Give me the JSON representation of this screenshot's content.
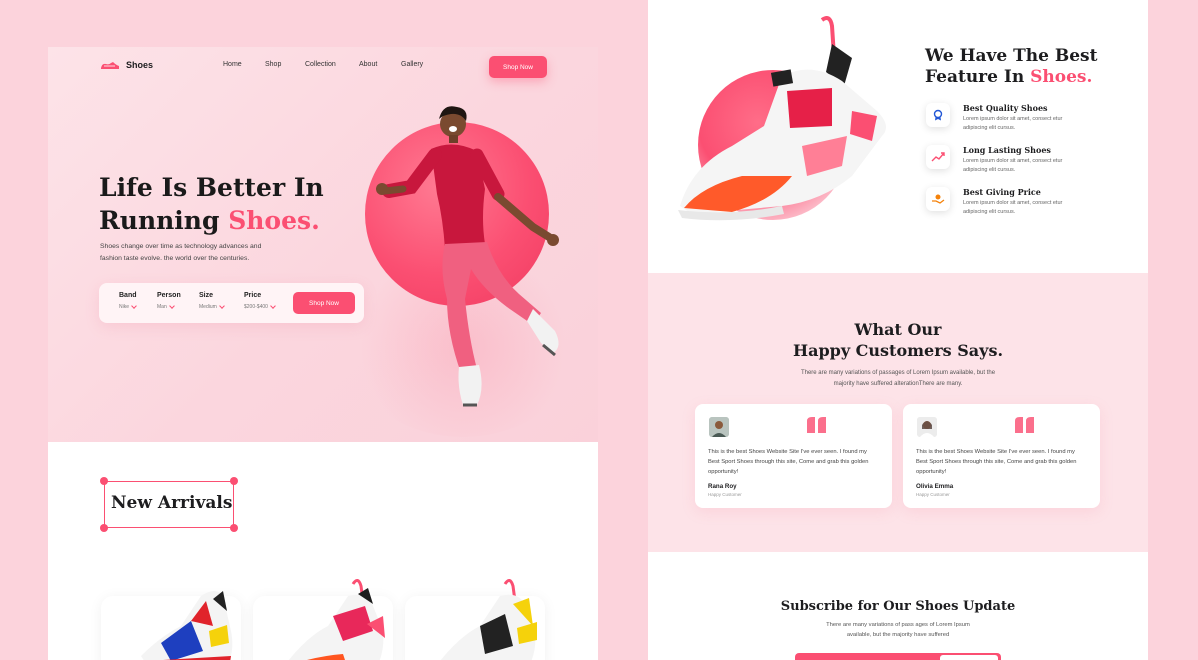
{
  "brand": {
    "name": "Shoes",
    "accent": "#fb4f72"
  },
  "nav": {
    "links": [
      "Home",
      "Shop",
      "Collection",
      "About",
      "Gallery"
    ],
    "cta": "Shop Now"
  },
  "hero": {
    "title_line1": "Life Is Better In",
    "title_line2_prefix": "Running",
    "title_line2_accent": "Shoes.",
    "description": "Shoes change over time as technology advances and fashion taste evolve. the world over the centuries.",
    "filters": [
      {
        "label": "Band",
        "value": "Nike"
      },
      {
        "label": "Person",
        "value": "Man"
      },
      {
        "label": "Size",
        "value": "Medium"
      },
      {
        "label": "Price",
        "value": "$200-$400"
      }
    ],
    "cta": "Shop Now"
  },
  "arrivals": {
    "title": "New Arrivals"
  },
  "features": {
    "title_line1": "We Have The Best",
    "title_line2_prefix": "Feature In",
    "title_line2_accent": "Shoes.",
    "items": [
      {
        "icon": "award-icon",
        "title": "Best Quality Shoes",
        "desc": "Lorem ipsum dolor sit amet, consect etur adipiscing elit cursus."
      },
      {
        "icon": "trend-up-icon",
        "title": "Long Lasting Shoes",
        "desc": "Lorem ipsum dolor sit amet, consect etur adipiscing elit cursus."
      },
      {
        "icon": "price-hand-icon",
        "title": "Best Giving Price",
        "desc": "Lorem ipsum dolor sit amet, consect etur adipiscing elit cursus."
      }
    ]
  },
  "testimonials": {
    "title_line1": "What Our",
    "title_line2": "Happy Customers Says.",
    "description": "There are many variations of passages of Lorem Ipsum available, but the majority have suffered alterationThere are many.",
    "items": [
      {
        "text": "This is the best Shoes Website Site I've ever seen. I found my Best Sport Shoes through this site, Come and grab this golden opportunity!",
        "name": "Rana Roy",
        "role": "Happy Customer"
      },
      {
        "text": "This is the best Shoes Website Site I've ever seen. I found my Best Sport Shoes through this site, Come and grab this golden opportunity!",
        "name": "Olivia Emma",
        "role": "Happy Customer"
      }
    ]
  },
  "subscribe": {
    "title": "Subscribe for Our Shoes Update",
    "description": "There are many variations of pass ages of Lorem Ipsum available, but the majority have suffered"
  }
}
